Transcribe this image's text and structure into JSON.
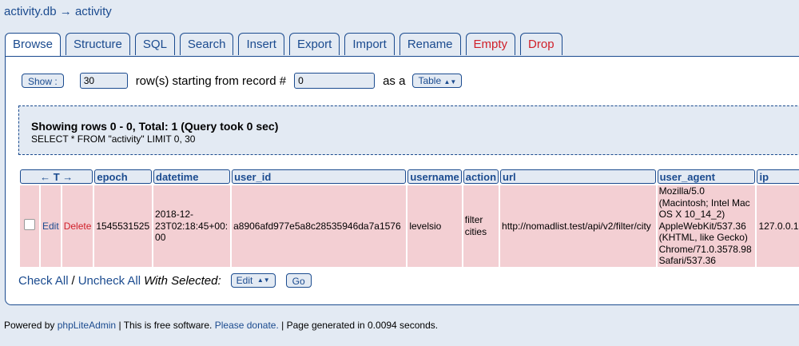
{
  "breadcrumb": {
    "db": "activity.db",
    "arrow": "→",
    "table": "activity"
  },
  "tabs": [
    {
      "label": "Browse"
    },
    {
      "label": "Structure"
    },
    {
      "label": "SQL"
    },
    {
      "label": "Search"
    },
    {
      "label": "Insert"
    },
    {
      "label": "Export"
    },
    {
      "label": "Import"
    },
    {
      "label": "Rename"
    },
    {
      "label": "Empty"
    },
    {
      "label": "Drop"
    }
  ],
  "show_row": {
    "button": "Show :",
    "count": "30",
    "text": "row(s) starting from record #",
    "start": "0",
    "as_text": "as a",
    "view_select": "Table"
  },
  "query": {
    "title": "Showing rows 0 - 0, Total: 1 (Query took 0 sec)",
    "sql": "SELECT * FROM \"activity\" LIMIT 0, 30"
  },
  "table": {
    "sort_header": "← T →",
    "columns": [
      "epoch",
      "datetime",
      "user_id",
      "username",
      "action",
      "url",
      "user_agent",
      "ip"
    ],
    "row": {
      "edit": "Edit",
      "delete": "Delete",
      "epoch": "1545531525",
      "datetime": "2018-12-23T02:18:45+00:00",
      "user_id": "a8906afd977e5a8c28535946da7a1576",
      "username": "levelsio",
      "action": "filter cities",
      "url": "http://nomadlist.test/api/v2/filter/city",
      "user_agent": "Mozilla/5.0 (Macintosh; Intel Mac OS X 10_14_2) AppleWebKit/537.36 (KHTML, like Gecko) Chrome/71.0.3578.98 Safari/537.36",
      "ip": "127.0.0.1"
    }
  },
  "bulk": {
    "check_all": "Check All",
    "separator": "/",
    "uncheck_all": "Uncheck All",
    "with_selected": "With Selected:",
    "action_select": "Edit",
    "go": "Go"
  },
  "footer": {
    "powered": "Powered by",
    "app": "phpLiteAdmin",
    "free": "| This is free software.",
    "donate": "Please donate.",
    "generated": "| Page generated in 0.0094 seconds."
  },
  "colors": {
    "accent": "#1b4b8f",
    "danger": "#d0202a",
    "row": "#f3cfd3",
    "bg": "#e3eaf3"
  }
}
